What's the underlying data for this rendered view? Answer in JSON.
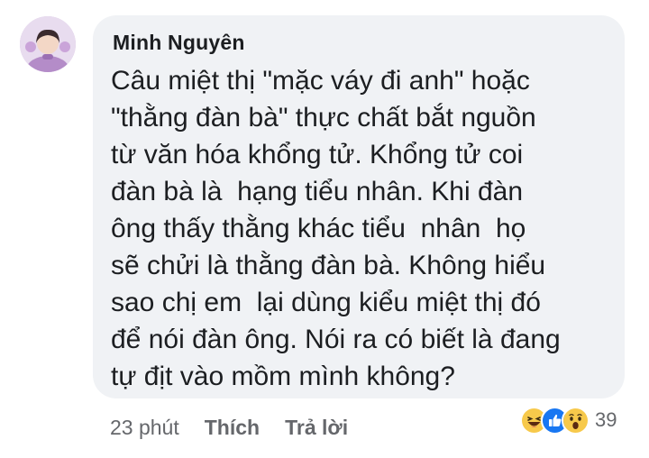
{
  "comment": {
    "author": "Minh Nguyên",
    "lines": [
      "Câu miệt thị \"mặc váy đi anh\" hoặc",
      "\"thằng đàn bà\" thực chất bắt nguồn",
      "từ văn hóa khổng tử. Khổng tử coi",
      "đàn bà là  hạng tiểu nhân. Khi đàn",
      "ông thấy thằng khác tiểu  nhân  họ",
      "sẽ chửi là thằng đàn bà. Không hiểu",
      "sao chị em  lại dùng kiểu miệt thị đó",
      "để nói đàn ông. Nói ra có biết là đang",
      "tự địt vào mồm mình không?"
    ]
  },
  "actions": {
    "time": "23 phút",
    "like_label": "Thích",
    "reply_label": "Trả lời"
  },
  "reactions": {
    "icons": [
      "haha-icon",
      "like-icon",
      "wow-icon"
    ],
    "count": "39"
  },
  "colors": {
    "bubble": "#f0f2f5",
    "text": "#1c1e21",
    "meta": "#65676b",
    "like_blue": "#1877f2",
    "emoji_yellow": "#f7c94b"
  }
}
